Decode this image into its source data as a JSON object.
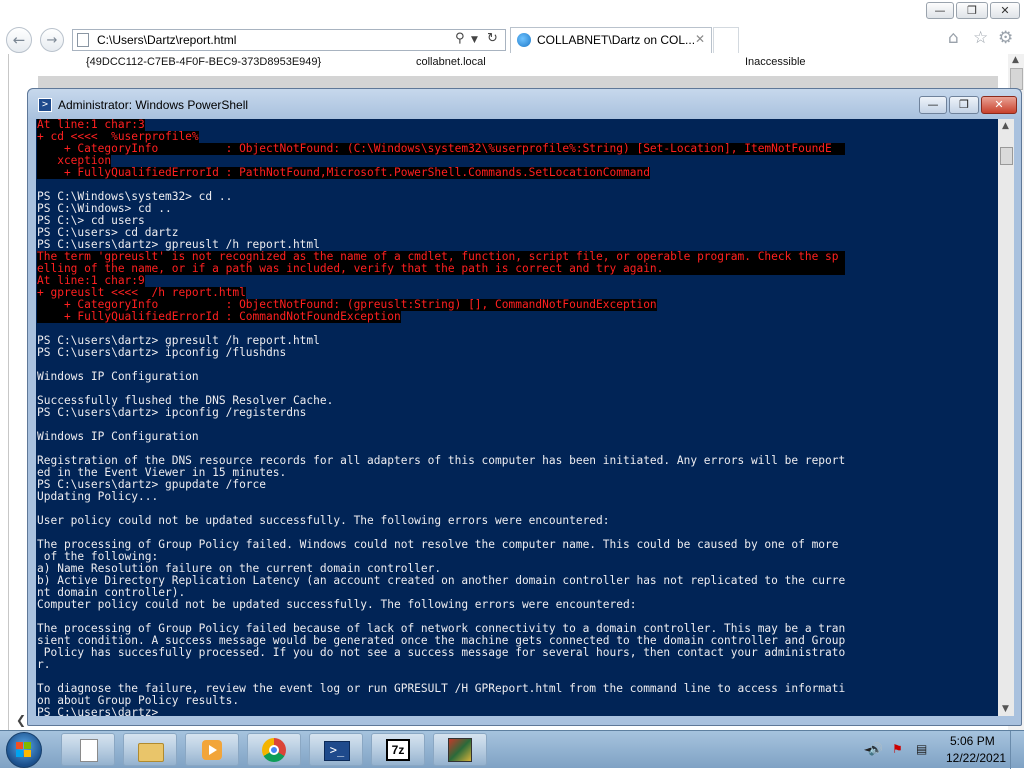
{
  "ie": {
    "address_url": "C:\\Users\\Dartz\\report.html",
    "tab_title": "COLLABNET\\Dartz on COL...",
    "content_row": {
      "guid": "{49DCC112-C7EB-4F0F-BEC9-373D8953E949}",
      "domain": "collabnet.local",
      "status": "Inaccessible"
    }
  },
  "powershell": {
    "title": "Administrator: Windows PowerShell",
    "lines": [
      {
        "t": "At line:1 char:3",
        "k": "err-partial"
      },
      {
        "t": "+ cd <<<<  %userprofile%",
        "k": "err-partial"
      },
      {
        "t": "    + CategoryInfo          : ObjectNotFound: (C:\\Windows\\system32\\%userprofile%:String) [Set-Location], ItemNotFoundE",
        "k": "err"
      },
      {
        "t": "   xception",
        "k": "err-partial"
      },
      {
        "t": "    + FullyQualifiedErrorId : PathNotFound,Microsoft.PowerShell.Commands.SetLocationCommand",
        "k": "err-partial"
      },
      {
        "t": "",
        "k": "white"
      },
      {
        "t": "PS C:\\Windows\\system32> cd ..",
        "k": "white"
      },
      {
        "t": "PS C:\\Windows> cd ..",
        "k": "white"
      },
      {
        "t": "PS C:\\> cd users",
        "k": "white"
      },
      {
        "t": "PS C:\\users> cd dartz",
        "k": "white"
      },
      {
        "t": "PS C:\\users\\dartz> gpreuslt /h report.html",
        "k": "white"
      },
      {
        "t": "The term 'gpreuslt' is not recognized as the name of a cmdlet, function, script file, or operable program. Check the sp",
        "k": "err"
      },
      {
        "t": "elling of the name, or if a path was included, verify that the path is correct and try again.",
        "k": "err"
      },
      {
        "t": "At line:1 char:9",
        "k": "err-partial"
      },
      {
        "t": "+ gpreuslt <<<<  /h report.html",
        "k": "err-partial"
      },
      {
        "t": "    + CategoryInfo          : ObjectNotFound: (gpreuslt:String) [], CommandNotFoundException",
        "k": "err-partial"
      },
      {
        "t": "    + FullyQualifiedErrorId : CommandNotFoundException",
        "k": "err-partial"
      },
      {
        "t": "",
        "k": "white"
      },
      {
        "t": "PS C:\\users\\dartz> gpresult /h report.html",
        "k": "white"
      },
      {
        "t": "PS C:\\users\\dartz> ipconfig /flushdns",
        "k": "white"
      },
      {
        "t": "",
        "k": "white"
      },
      {
        "t": "Windows IP Configuration",
        "k": "white"
      },
      {
        "t": "",
        "k": "white"
      },
      {
        "t": "Successfully flushed the DNS Resolver Cache.",
        "k": "white"
      },
      {
        "t": "PS C:\\users\\dartz> ipconfig /registerdns",
        "k": "white"
      },
      {
        "t": "",
        "k": "white"
      },
      {
        "t": "Windows IP Configuration",
        "k": "white"
      },
      {
        "t": "",
        "k": "white"
      },
      {
        "t": "Registration of the DNS resource records for all adapters of this computer has been initiated. Any errors will be report",
        "k": "white"
      },
      {
        "t": "ed in the Event Viewer in 15 minutes.",
        "k": "white"
      },
      {
        "t": "PS C:\\users\\dartz> gpupdate /force",
        "k": "white"
      },
      {
        "t": "Updating Policy...",
        "k": "white"
      },
      {
        "t": "",
        "k": "white"
      },
      {
        "t": "User policy could not be updated successfully. The following errors were encountered:",
        "k": "white"
      },
      {
        "t": "",
        "k": "white"
      },
      {
        "t": "The processing of Group Policy failed. Windows could not resolve the computer name. This could be caused by one of more",
        "k": "white"
      },
      {
        "t": " of the following:",
        "k": "white"
      },
      {
        "t": "a) Name Resolution failure on the current domain controller.",
        "k": "white"
      },
      {
        "t": "b) Active Directory Replication Latency (an account created on another domain controller has not replicated to the curre",
        "k": "white"
      },
      {
        "t": "nt domain controller).",
        "k": "white"
      },
      {
        "t": "Computer policy could not be updated successfully. The following errors were encountered:",
        "k": "white"
      },
      {
        "t": "",
        "k": "white"
      },
      {
        "t": "The processing of Group Policy failed because of lack of network connectivity to a domain controller. This may be a tran",
        "k": "white"
      },
      {
        "t": "sient condition. A success message would be generated once the machine gets connected to the domain controller and Group",
        "k": "white"
      },
      {
        "t": " Policy has succesfully processed. If you do not see a success message for several hours, then contact your administrato",
        "k": "white"
      },
      {
        "t": "r.",
        "k": "white"
      },
      {
        "t": "",
        "k": "white"
      },
      {
        "t": "To diagnose the failure, review the event log or run GPRESULT /H GPReport.html from the command line to access informati",
        "k": "white"
      },
      {
        "t": "on about Group Policy results.",
        "k": "white"
      },
      {
        "t": "PS C:\\users\\dartz>",
        "k": "white"
      }
    ]
  },
  "taskbar": {
    "apps": [
      {
        "name": "blank-document-icon"
      },
      {
        "name": "windows-explorer-icon"
      },
      {
        "name": "media-player-icon"
      },
      {
        "name": "chrome-icon"
      },
      {
        "name": "powershell-icon"
      },
      {
        "name": "7zip-icon"
      },
      {
        "name": "game-icon"
      }
    ],
    "clock_time": "5:06 PM",
    "clock_date": "12/22/2021"
  },
  "colors": {
    "console_bg": "#012456",
    "console_text": "#eeedf0",
    "error_text": "#ff2020",
    "error_bg": "#000000"
  }
}
